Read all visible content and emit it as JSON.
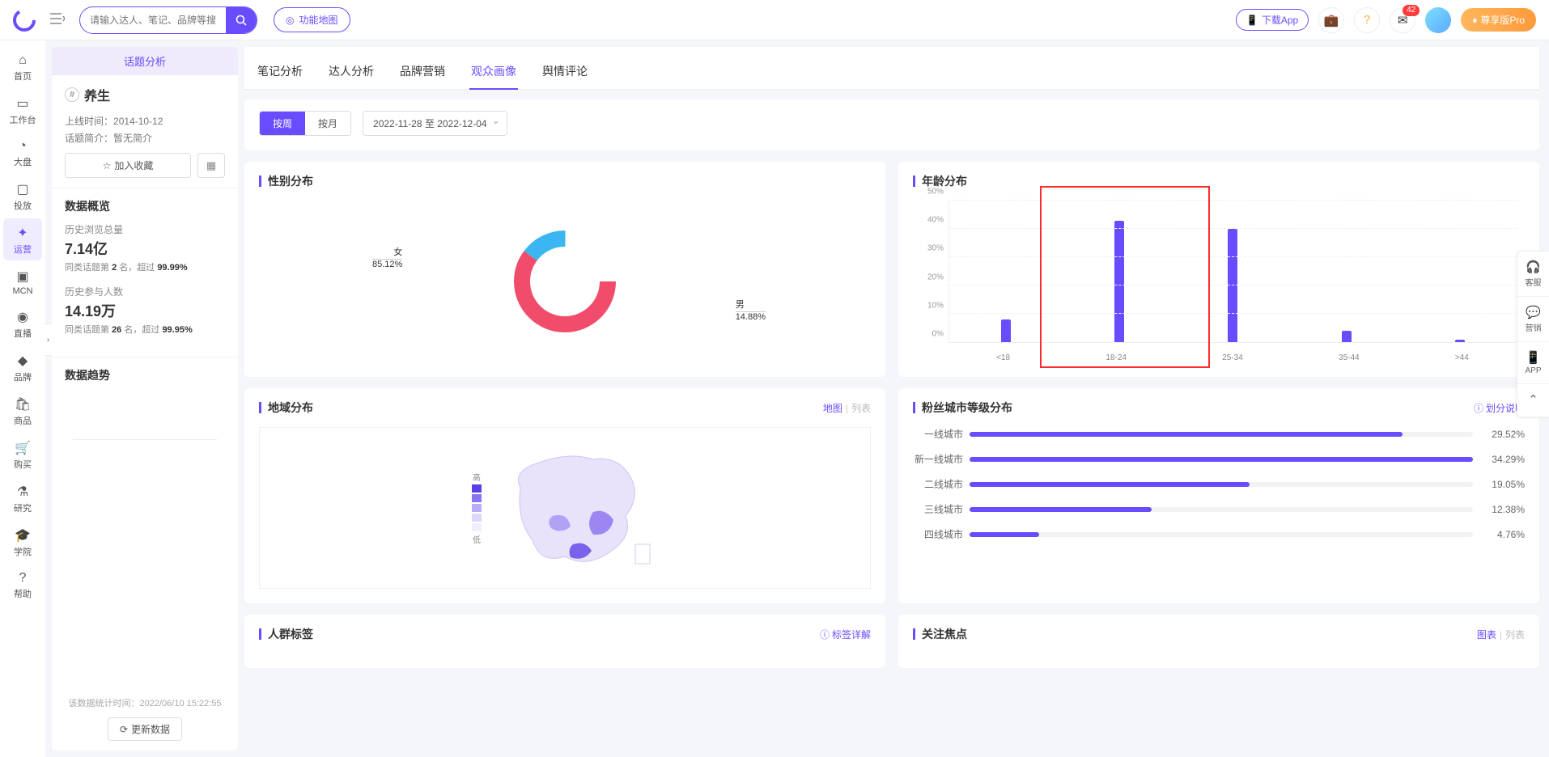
{
  "header": {
    "search_placeholder": "请输入达人、笔记、品牌等搜索",
    "func_map": "功能地图",
    "download_app": "下载App",
    "notif_count": "42",
    "pro_btn": "尊享版Pro"
  },
  "nav": [
    {
      "icon": "⌂",
      "label": "首页"
    },
    {
      "icon": "▭",
      "label": "工作台"
    },
    {
      "icon": "◔",
      "label": "大盘"
    },
    {
      "icon": "▢",
      "label": "投放"
    },
    {
      "icon": "✦",
      "label": "运营",
      "active": true
    },
    {
      "icon": "▣",
      "label": "MCN"
    },
    {
      "icon": "◉",
      "label": "直播"
    },
    {
      "icon": "◆",
      "label": "品牌"
    },
    {
      "icon": "🛍",
      "label": "商品"
    },
    {
      "icon": "🛒",
      "label": "购买"
    },
    {
      "icon": "⚗",
      "label": "研究"
    },
    {
      "icon": "🎓",
      "label": "学院"
    },
    {
      "icon": "?",
      "label": "帮助"
    }
  ],
  "side": {
    "panel_title": "话题分析",
    "topic_name": "养生",
    "online_time_label": "上线时间：",
    "online_time": "2014-10-12",
    "intro_label": "话题简介：",
    "intro": "暂无简介",
    "fav_btn": "加入收藏",
    "overview_head": "数据概览",
    "views_label": "历史浏览总量",
    "views_value": "7.14亿",
    "views_rank_prefix": "同类话题第 ",
    "views_rank": "2",
    "views_rank_mid": " 名，超过 ",
    "views_pct": "99.99%",
    "part_label": "历史参与人数",
    "part_value": "14.19万",
    "part_rank_prefix": "同类话题第 ",
    "part_rank": "26",
    "part_rank_mid": " 名，超过 ",
    "part_pct": "99.95%",
    "trend_head": "数据趋势",
    "stat_time_label": "该数据统计时间：",
    "stat_time": "2022/06/10 15:22:55",
    "refresh": "更新数据"
  },
  "tabs": [
    "笔记分析",
    "达人分析",
    "品牌营销",
    "观众画像",
    "舆情评论"
  ],
  "active_tab": 3,
  "filter": {
    "seg_week": "按周",
    "seg_month": "按月",
    "date_range": "2022-11-28 至 2022-12-04"
  },
  "gender": {
    "title": "性别分布",
    "female_label": "女",
    "female_pct": "85.12%",
    "male_label": "男",
    "male_pct": "14.88%"
  },
  "age": {
    "title": "年龄分布"
  },
  "chart_data": {
    "type": "bar",
    "categories": [
      "<18",
      "18-24",
      "25-34",
      "35-44",
      ">44"
    ],
    "values": [
      8,
      43,
      40,
      4,
      1
    ],
    "y_ticks": [
      "0%",
      "10%",
      "20%",
      "30%",
      "40%",
      "50%"
    ],
    "ymax": 50,
    "ylabel": "",
    "xlabel": "",
    "title": "年龄分布"
  },
  "geo": {
    "title": "地域分布",
    "view_map": "地图",
    "view_list": "列表",
    "legend_high": "高",
    "legend_low": "低"
  },
  "city": {
    "title": "粉丝城市等级分布",
    "help": "划分说明",
    "tiers": [
      {
        "label": "一线城市",
        "pct": 29.52
      },
      {
        "label": "新一线城市",
        "pct": 34.29
      },
      {
        "label": "二线城市",
        "pct": 19.05
      },
      {
        "label": "三线城市",
        "pct": 12.38
      },
      {
        "label": "四线城市",
        "pct": 4.76
      }
    ]
  },
  "tags": {
    "title": "人群标签",
    "help": "标签详解"
  },
  "focus": {
    "title": "关注焦点",
    "view_chart": "图表",
    "view_list": "列表"
  },
  "float_bar": [
    {
      "icon": "🎧",
      "label": "客服"
    },
    {
      "icon": "💬",
      "label": "营销"
    },
    {
      "icon": "📱",
      "label": "APP"
    },
    {
      "icon": "⌃",
      "label": ""
    }
  ]
}
